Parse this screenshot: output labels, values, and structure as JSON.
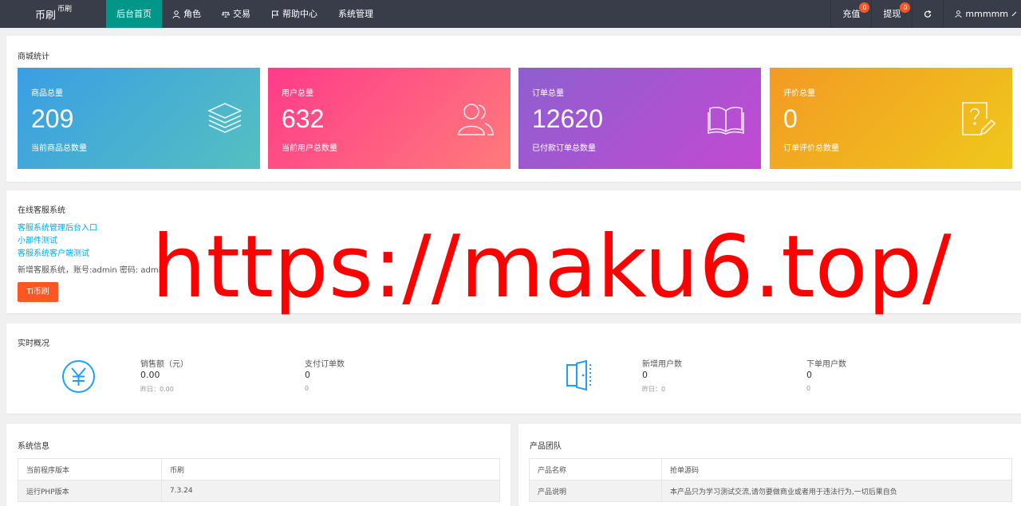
{
  "header": {
    "logo": "币刷",
    "logo_sup": "币刷",
    "nav": [
      {
        "label": "后台首页",
        "icon": "",
        "active": true
      },
      {
        "label": "角色",
        "icon": "user-icon"
      },
      {
        "label": "交易",
        "icon": "scale-icon"
      },
      {
        "label": "帮助中心",
        "icon": "flag-icon"
      },
      {
        "label": "系统管理",
        "icon": ""
      }
    ],
    "recharge": {
      "label": "充值",
      "badge": "0"
    },
    "withdraw": {
      "label": "提现",
      "badge": "0"
    },
    "username": "mmmmm"
  },
  "mall_stats": {
    "title": "商城统计",
    "cards": [
      {
        "label": "商品总量",
        "value": "209",
        "desc": "当前商品总数量",
        "icon": "layers-icon",
        "colors": [
          "#3a9ee4",
          "#55c0c0"
        ]
      },
      {
        "label": "用户总量",
        "value": "632",
        "desc": "当前用户总数量",
        "icon": "users-icon",
        "colors": [
          "#ff3b8a",
          "#ff7b7b"
        ]
      },
      {
        "label": "订单总量",
        "value": "12620",
        "desc": "已付款订单总数量",
        "icon": "book-icon",
        "colors": [
          "#8e5fd0",
          "#c24ad2"
        ]
      },
      {
        "label": "评价总量",
        "value": "0",
        "desc": "订单评价总数量",
        "icon": "edit-question-icon",
        "colors": [
          "#f39a24",
          "#efc81c"
        ]
      }
    ]
  },
  "customer_service": {
    "title": "在线客服系统",
    "links": [
      "客服系统管理后台入口",
      "小部件测试",
      "客服系统客户端测试"
    ],
    "note": "新增客服系统，账号:admin 密码: admin",
    "button": "Ti币刷"
  },
  "realtime": {
    "title": "实时概况",
    "items": [
      {
        "label": "销售额（元）",
        "value": "0.00",
        "sub": "昨日：0.00"
      },
      {
        "label": "支付订单数",
        "value": "0",
        "sub": "0"
      },
      {
        "label": "新增用户数",
        "value": "0",
        "sub": "昨日：0"
      },
      {
        "label": "下单用户数",
        "value": "0",
        "sub": "0"
      }
    ]
  },
  "system_info": {
    "title": "系统信息",
    "rows": [
      [
        "当前程序版本",
        "币刷"
      ],
      [
        "运行PHP版本",
        "7.3.24"
      ]
    ]
  },
  "product_team": {
    "title": "产品团队",
    "rows": [
      [
        "产品名称",
        "抢单源码"
      ],
      [
        "产品说明",
        "本产品只为学习测试交流,请勿要做商业或者用于违法行为,一切后果自负"
      ]
    ]
  },
  "watermark": "https://maku6.top/"
}
